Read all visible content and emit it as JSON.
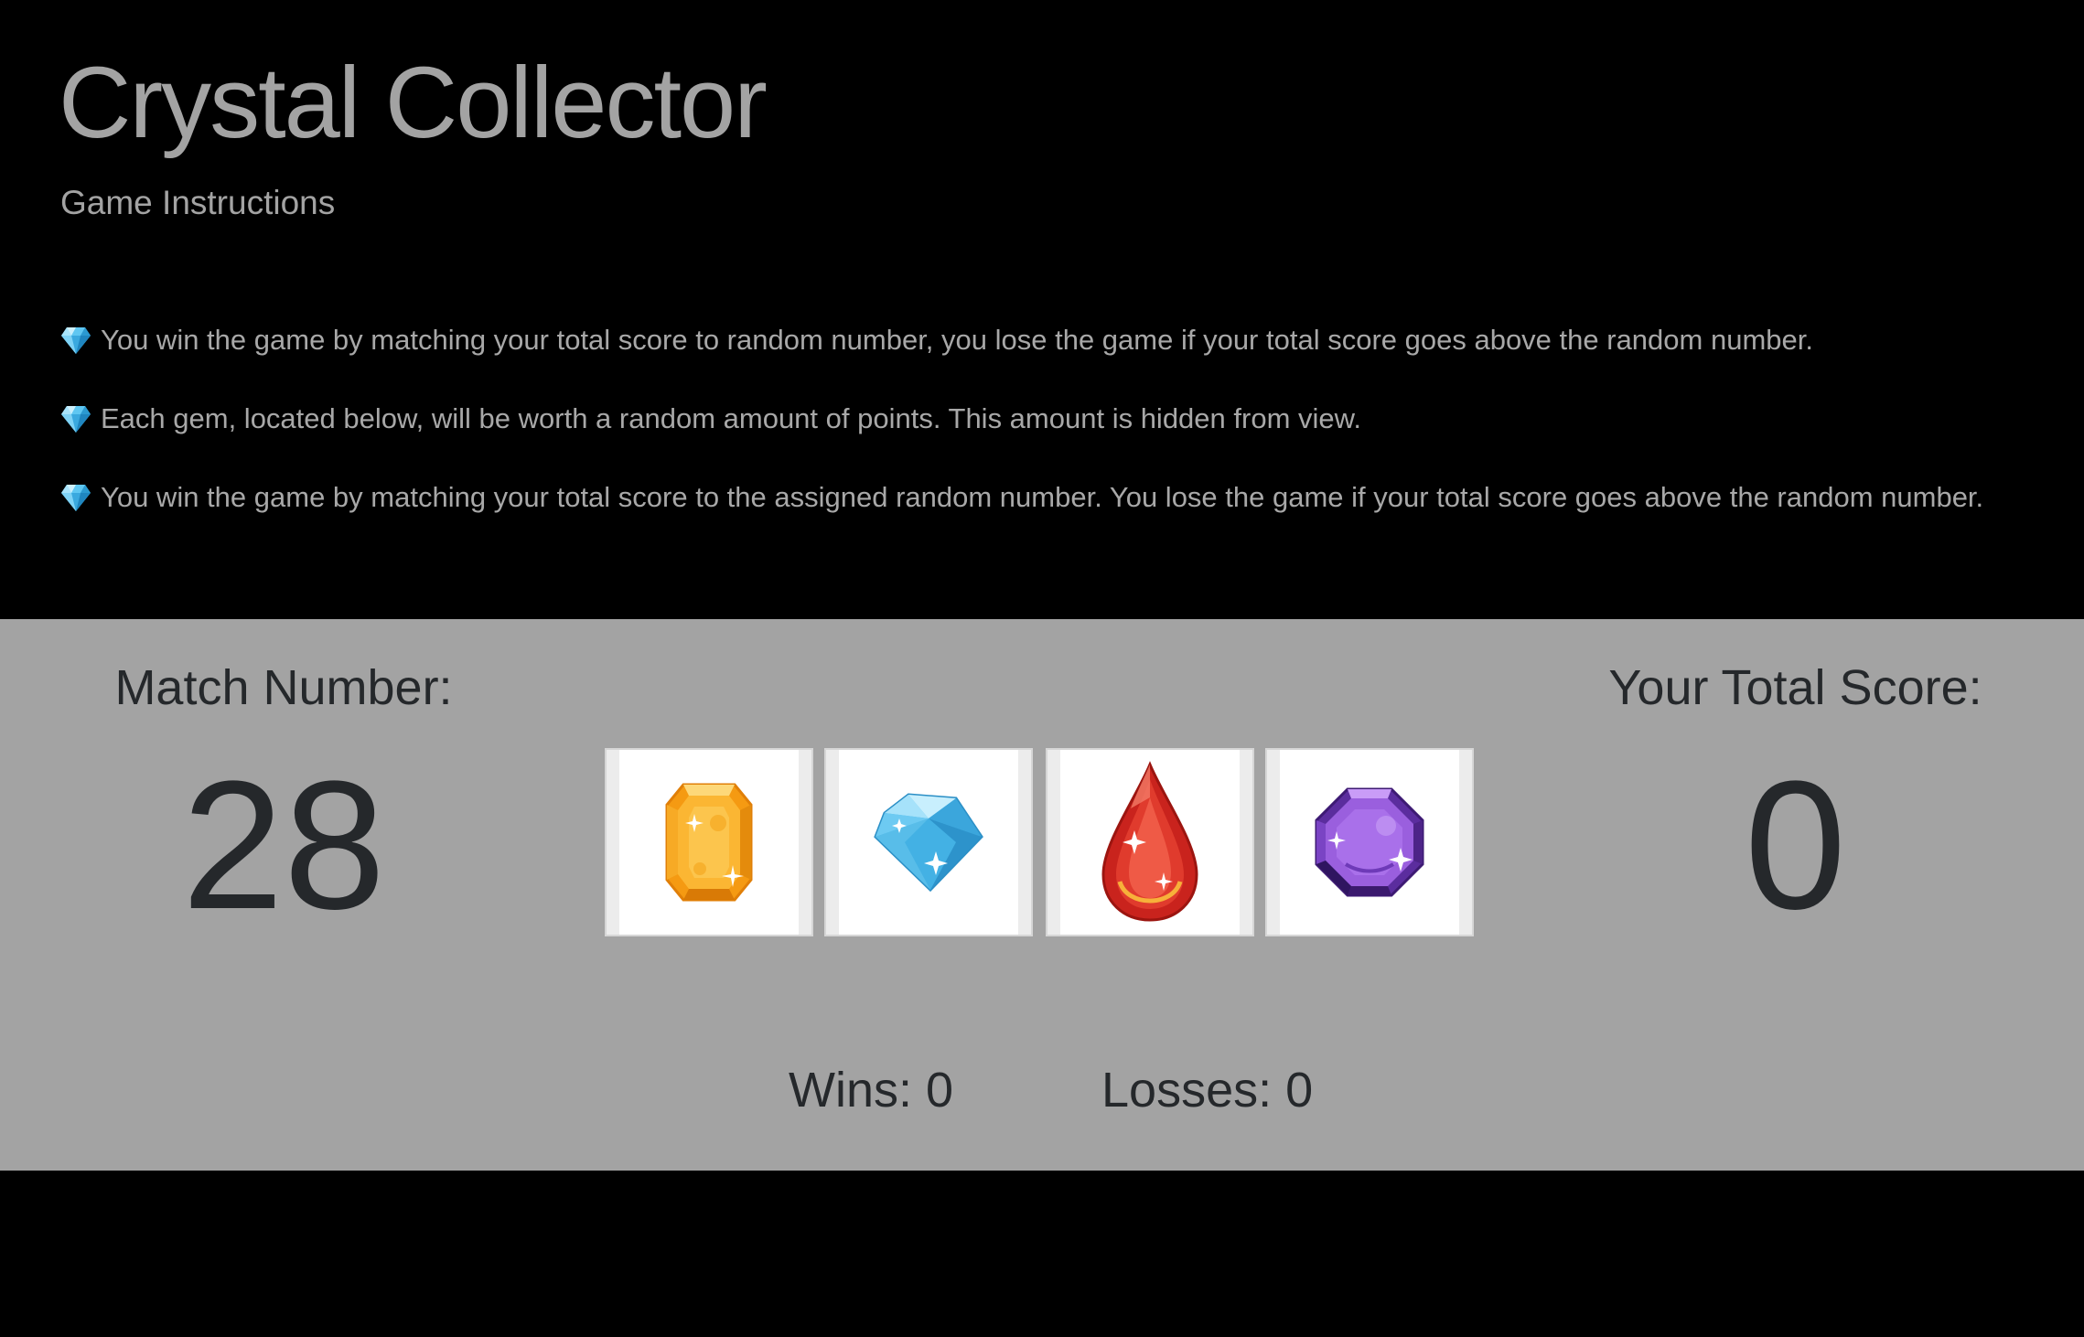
{
  "header": {
    "title": "Crystal Collector",
    "subtitle": "Game Instructions",
    "instructions": [
      "You win the game by matching your total score to random number, you lose the game if your total score goes above the random number.",
      "Each gem, located below, will be worth a random amount of points. This amount is hidden from view.",
      "You win the game by matching your total score to the assigned random number. You lose the game if your total score goes above the random number."
    ],
    "bullet_icon": "gem-icon"
  },
  "game": {
    "match_label": "Match Number:",
    "match_number": "28",
    "score_label": "Your Total Score:",
    "score_number": "0",
    "crystals": [
      {
        "name": "orange-crystal",
        "icon": "orange-gem-icon",
        "color": "#f7a21d"
      },
      {
        "name": "blue-crystal",
        "icon": "blue-diamond-icon",
        "color": "#4ab8ea"
      },
      {
        "name": "red-crystal",
        "icon": "red-drop-gem-icon",
        "color": "#c9231d"
      },
      {
        "name": "purple-crystal",
        "icon": "purple-gem-icon",
        "color": "#8a4fd0"
      }
    ],
    "wins_text": "Wins: 0",
    "losses_text": "Losses: 0"
  },
  "colors": {
    "background": "#000000",
    "panel": "#a3a3a3",
    "heading_text": "#a3a3a3",
    "panel_text": "#25282b"
  }
}
